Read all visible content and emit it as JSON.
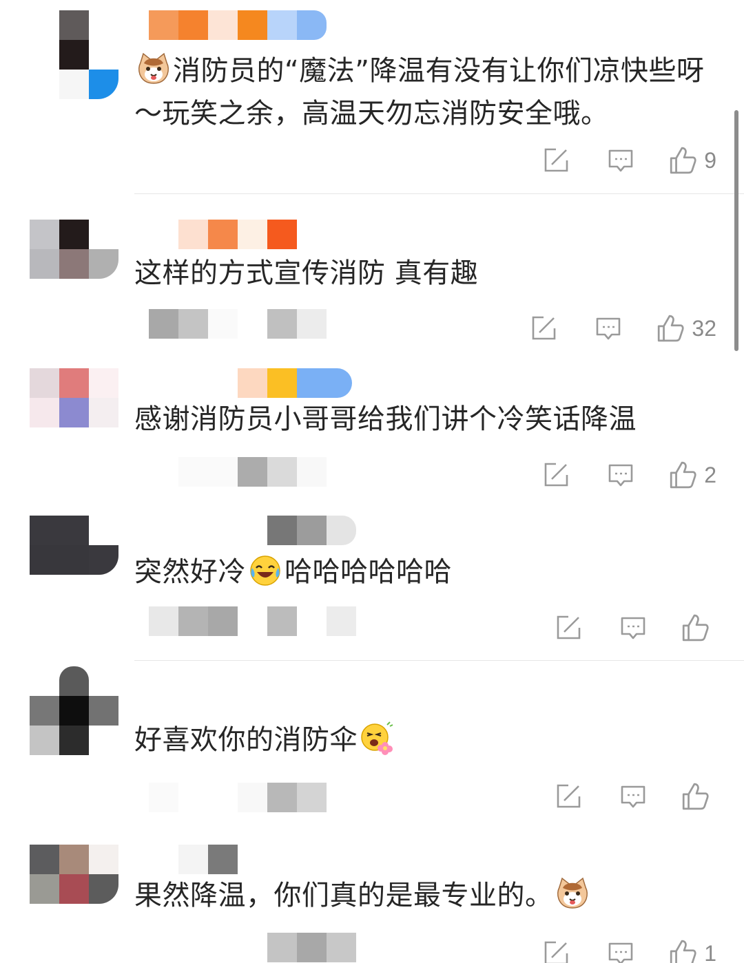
{
  "comments": [
    {
      "text_before": "消防员的“魔法”降温有没有让你们凉快些呀～玩笑之余，高温天勿忘消防安全哦。",
      "likes": "9"
    },
    {
      "text_before": "这样的方式宣传消防 真有趣",
      "likes": "32"
    },
    {
      "text_before": "感谢消防员小哥哥给我们讲个冷笑话降温",
      "likes": "2"
    },
    {
      "text_before": "突然好冷",
      "text_after": "哈哈哈哈哈哈",
      "likes": ""
    },
    {
      "text_before": "好喜欢你的消防伞",
      "likes": ""
    },
    {
      "text_before": "果然降温，你们真的是最专业的。",
      "likes": "1"
    }
  ],
  "icons": {
    "share": "share-icon",
    "reply": "comment-icon",
    "like": "thumbs-up-icon",
    "emoji_cat": "cat-face-emoji-icon",
    "emoji_laugh": "laughing-crying-emoji-icon",
    "emoji_flower": "flower-face-emoji-icon"
  },
  "colors": {
    "text": "#262626",
    "icon": "#9a9a9a",
    "count": "#8a8a8a",
    "divider": "#e6e6e6"
  }
}
